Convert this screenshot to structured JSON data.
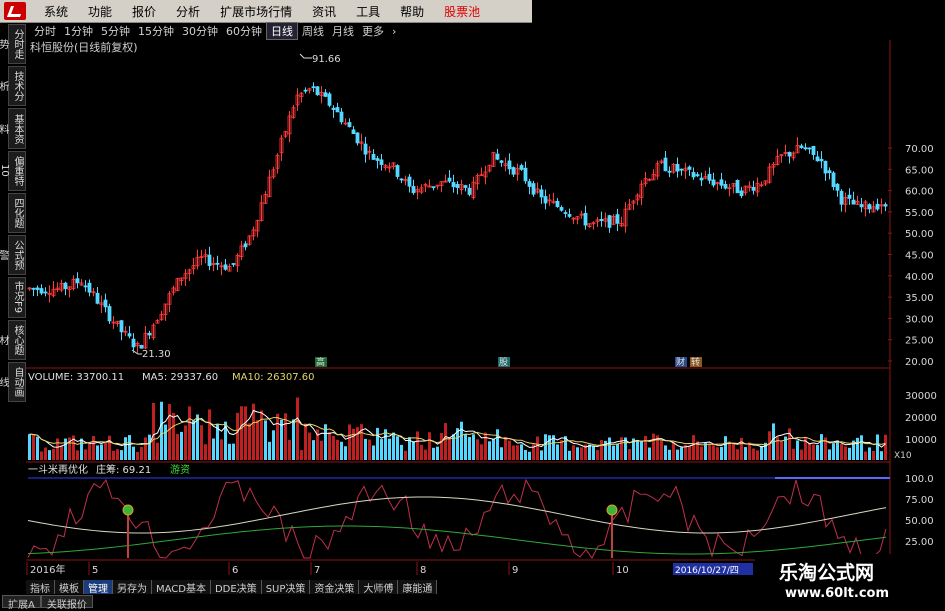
{
  "menu": [
    "系统",
    "功能",
    "报价",
    "分析",
    "扩展市场行情",
    "资讯",
    "工具",
    "帮助",
    "股票池"
  ],
  "periods": [
    "分时",
    "1分钟",
    "5分钟",
    "15分钟",
    "30分钟",
    "60分钟",
    "日线",
    "周线",
    "月线",
    "更多",
    "›"
  ],
  "active_period": "日线",
  "stock_title": "科恒股份(日线前复权)",
  "sidebar": [
    "分时走势",
    "技术分析",
    "基本资料",
    "偏重特10",
    "四化题",
    "公式预警",
    "市况F9",
    "核心题材",
    "自动画线"
  ],
  "price_axis": [
    "70.00",
    "65.00",
    "60.00",
    "55.00",
    "50.00",
    "45.00",
    "40.00",
    "35.00",
    "30.00",
    "25.00",
    "20.00"
  ],
  "price_labels": {
    "high": "91.66",
    "low": "21.30"
  },
  "event_marks": [
    "高",
    "股",
    "财",
    "转"
  ],
  "volume_header": {
    "volume": "VOLUME: 33700.11",
    "ma5": "MA5: 29337.60",
    "ma10": "MA10: 26307.60"
  },
  "volume_axis": [
    "30000",
    "20000",
    "10000"
  ],
  "volume_unit": "X10",
  "indicator_header": {
    "name": "一斗米再优化",
    "zhuang": "庄筹: 69.21",
    "youzi": "游资"
  },
  "indicator_axis": [
    "100.0",
    "75.00",
    "50.00",
    "25.00"
  ],
  "date_axis": [
    "2016年",
    "5",
    "6",
    "7",
    "8",
    "9",
    "10"
  ],
  "date_cursor": "2016/10/27/四",
  "toolbar": [
    "指标",
    "模板",
    "管理",
    "另存为",
    "MACD基本",
    "DDE决策",
    "SUP决策",
    "资金决策",
    "大师傅",
    "康能通"
  ],
  "active_tool": "管理",
  "bottom_tabs": [
    "扩展A",
    "关联报价"
  ],
  "watermark": {
    "line1": "乐淘公式网",
    "line2": "www.60lt.com"
  },
  "colors": {
    "up": "#ff3b3b",
    "down": "#54d8ff",
    "accent": "#e00000",
    "grid": "#8b1414"
  }
}
